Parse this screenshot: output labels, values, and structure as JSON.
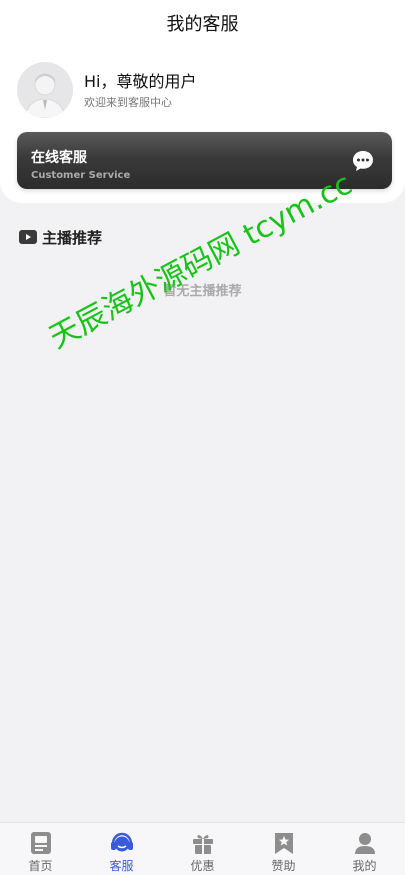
{
  "header": {
    "title": "我的客服"
  },
  "profile": {
    "greeting": "Hi，尊敬的用户",
    "welcome": "欢迎来到客服中心"
  },
  "service": {
    "title": "在线客服",
    "subtitle": "Customer Service",
    "icon": "chat-bubble-icon"
  },
  "section": {
    "title": "主播推荐",
    "icon": "play-icon",
    "empty_text": "暂无主播推荐"
  },
  "watermark": "天辰海外源码网 tcym.cc",
  "tabs": [
    {
      "label": "首页",
      "icon": "home-doc-icon"
    },
    {
      "label": "客服",
      "icon": "headset-icon",
      "active": true
    },
    {
      "label": "优惠",
      "icon": "gift-icon"
    },
    {
      "label": "赞助",
      "icon": "bookmark-star-icon"
    },
    {
      "label": "我的",
      "icon": "user-icon"
    }
  ],
  "colors": {
    "active": "#3a5bd9",
    "inactive_icon": "#8d8d8d",
    "background": "#f2f2f4",
    "watermark": "#17c317"
  }
}
